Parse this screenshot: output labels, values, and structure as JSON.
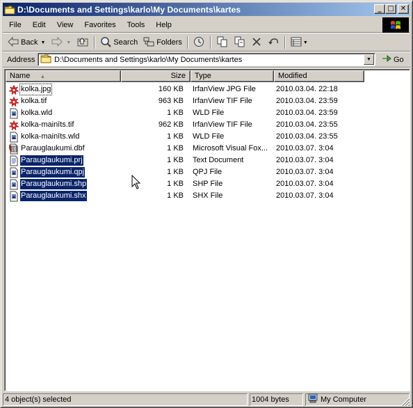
{
  "window": {
    "title": "D:\\Documents and Settings\\karlo\\My Documents\\kartes",
    "controls": {
      "minimize": "_",
      "maximize": "□",
      "close": "✕"
    }
  },
  "menu": [
    "File",
    "Edit",
    "View",
    "Favorites",
    "Tools",
    "Help"
  ],
  "toolbar": {
    "back_label": "Back",
    "search_label": "Search",
    "folders_label": "Folders"
  },
  "address": {
    "label": "Address",
    "value": "D:\\Documents and Settings\\karlo\\My Documents\\kartes",
    "go_label": "Go"
  },
  "columns": {
    "name": "Name",
    "size": "Size",
    "type": "Type",
    "modified": "Modified"
  },
  "files": [
    {
      "name": "kolka.jpg",
      "size": "160 KB",
      "type": "IrfanView JPG File",
      "modified": "2010.03.04. 22:18",
      "icon": "irfanview-icon",
      "selected": false,
      "focused": true
    },
    {
      "name": "kolka.tif",
      "size": "963 KB",
      "type": "IrfanView TIF File",
      "modified": "2010.03.04. 23:59",
      "icon": "irfanview-icon",
      "selected": false,
      "focused": false
    },
    {
      "name": "kolka.wld",
      "size": "1 KB",
      "type": "WLD File",
      "modified": "2010.03.04. 23:59",
      "icon": "generic-file-icon",
      "selected": false,
      "focused": false
    },
    {
      "name": "kolka-mainīts.tif",
      "size": "962 KB",
      "type": "IrfanView TIF File",
      "modified": "2010.03.04. 23:55",
      "icon": "irfanview-icon",
      "selected": false,
      "focused": false
    },
    {
      "name": "kolka-mainīts.wld",
      "size": "1 KB",
      "type": "WLD File",
      "modified": "2010.03.04. 23:55",
      "icon": "generic-file-icon",
      "selected": false,
      "focused": false
    },
    {
      "name": "Parauglaukumi.dbf",
      "size": "1 KB",
      "type": "Microsoft Visual Fox...",
      "modified": "2010.03.07. 3:04",
      "icon": "foxpro-table-icon",
      "selected": false,
      "focused": false
    },
    {
      "name": "Parauglaukumi.prj",
      "size": "1 KB",
      "type": "Text Document",
      "modified": "2010.03.07. 3:04",
      "icon": "text-document-icon",
      "selected": true,
      "focused": false
    },
    {
      "name": "Parauglaukumi.qpj",
      "size": "1 KB",
      "type": "QPJ File",
      "modified": "2010.03.07. 3:04",
      "icon": "generic-file-icon",
      "selected": true,
      "focused": false
    },
    {
      "name": "Parauglaukumi.shp",
      "size": "1 KB",
      "type": "SHP File",
      "modified": "2010.03.07. 3:04",
      "icon": "generic-file-icon",
      "selected": true,
      "focused": false
    },
    {
      "name": "Parauglaukumi.shx",
      "size": "1 KB",
      "type": "SHX File",
      "modified": "2010.03.07. 3:04",
      "icon": "generic-file-icon",
      "selected": true,
      "focused": false
    }
  ],
  "status": {
    "selection": "4 object(s) selected",
    "size": "1004 bytes",
    "zone": "My Computer"
  },
  "colors": {
    "selection": "#0a246a",
    "title_start": "#0a246a",
    "title_end": "#a6caf0",
    "chrome": "#d4d0c8"
  }
}
